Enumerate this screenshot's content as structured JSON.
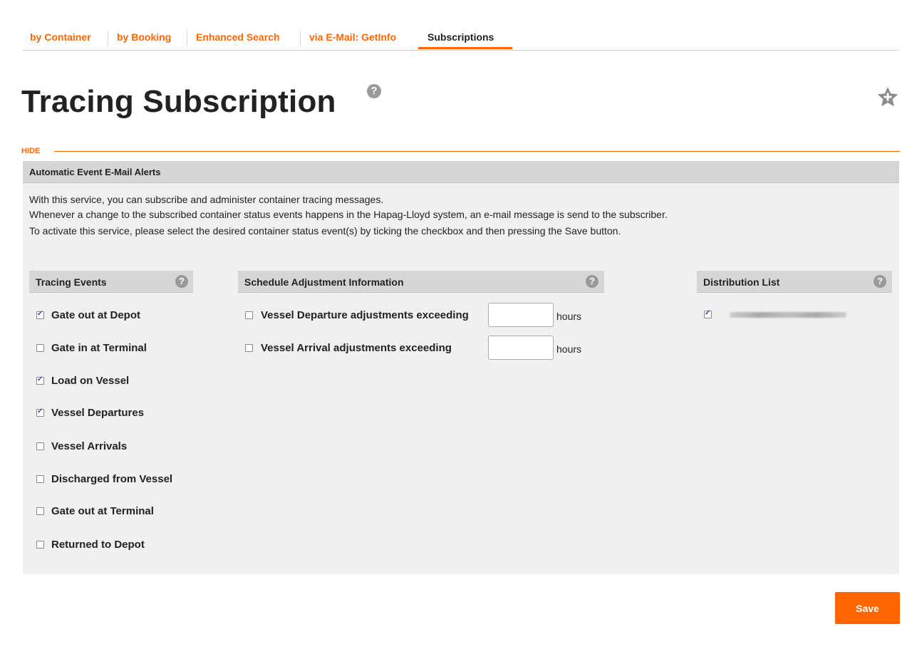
{
  "tabs": [
    {
      "label": "by Container",
      "active": false
    },
    {
      "label": "by Booking",
      "active": false
    },
    {
      "label": "Enhanced Search",
      "active": false
    },
    {
      "label": "via E-Mail: GetInfo",
      "active": false
    },
    {
      "label": "Subscriptions",
      "active": true
    }
  ],
  "page": {
    "title": "Tracing Subscription",
    "help_glyph": "?",
    "favorite_icon": "star-plus-icon"
  },
  "hide_link": "HIDE",
  "alerts": {
    "header": "Automatic Event E-Mail Alerts",
    "description": [
      "With this service, you can subscribe and administer container tracing messages.",
      "Whenever a change to the subscribed container status events happens in the Hapag-Lloyd system, an e-mail message is send to the subscriber.",
      "To activate this service, please select the desired container status event(s) by ticking the checkbox and then pressing the Save button."
    ]
  },
  "tracing_events": {
    "header": "Tracing Events",
    "items": [
      {
        "label": "Gate out at Depot",
        "checked": true
      },
      {
        "label": "Gate in at Terminal",
        "checked": false
      },
      {
        "label": "Load on Vessel",
        "checked": true
      },
      {
        "label": "Vessel Departures",
        "checked": true
      },
      {
        "label": "Vessel Arrivals",
        "checked": false
      },
      {
        "label": "Discharged from Vessel",
        "checked": false
      },
      {
        "label": "Gate out at Terminal",
        "checked": false
      },
      {
        "label": "Returned to Depot",
        "checked": false
      }
    ]
  },
  "schedule": {
    "header": "Schedule Adjustment Information",
    "items": [
      {
        "label": "Vessel Departure adjustments exceeding",
        "checked": false,
        "value": "",
        "unit": "hours"
      },
      {
        "label": "Vessel Arrival adjustments exceeding",
        "checked": false,
        "value": "",
        "unit": "hours"
      }
    ]
  },
  "distribution": {
    "header": "Distribution List",
    "items": [
      {
        "checked": true
      }
    ]
  },
  "save_label": "Save",
  "colors": {
    "accent": "#ff6600",
    "panel_bg": "#f0f0f0",
    "header_bg": "#d6d6d6"
  }
}
